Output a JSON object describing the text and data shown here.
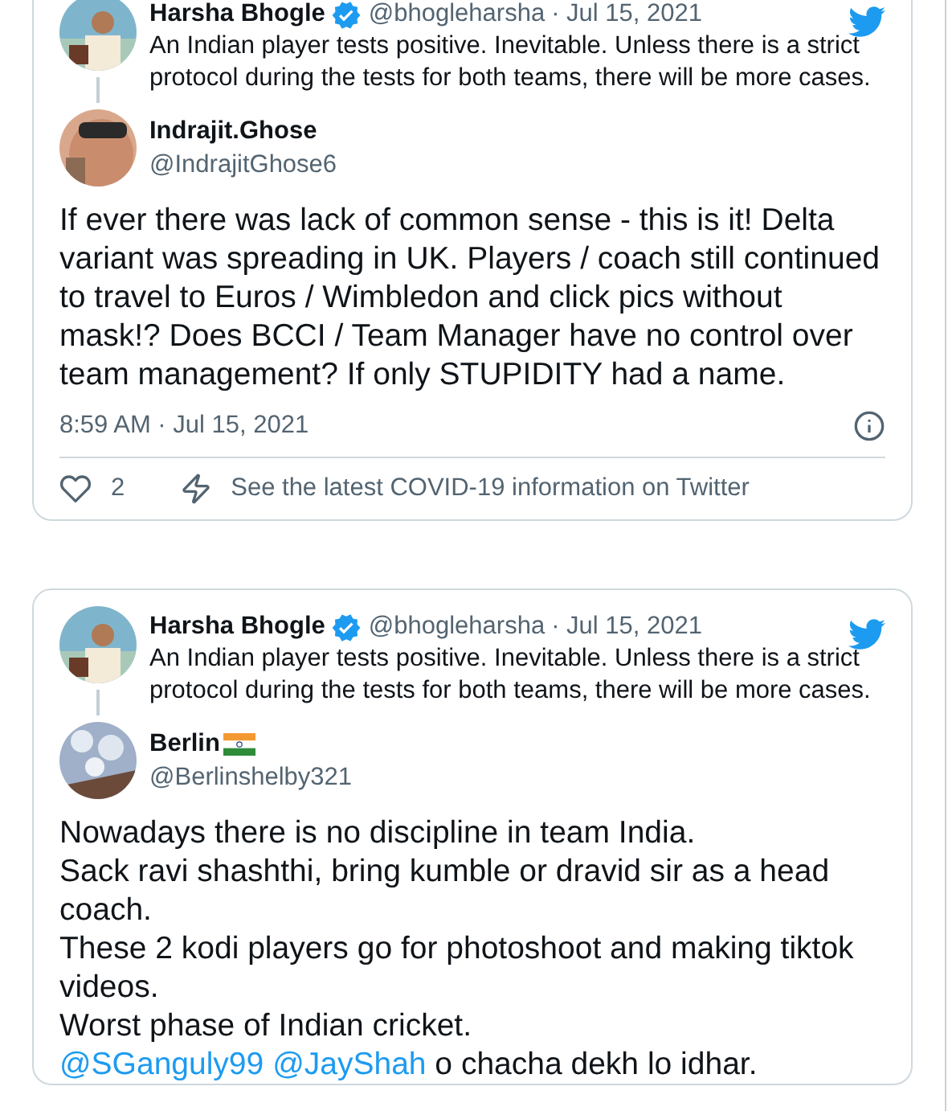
{
  "cards": [
    {
      "quoted": {
        "name": "Harsha Bhogle",
        "verified": true,
        "handle": "@bhogleharsha",
        "date": "· Jul 15, 2021",
        "text": "An Indian player tests positive. Inevitable. Unless there is a strict protocol during the tests for both teams, there will be more cases."
      },
      "reply": {
        "name": "Indrajit.Ghose",
        "handle": "@IndrajitGhose6",
        "body": [
          {
            "kind": "text",
            "text": "If ever there was lack of common sense - this is it! Delta variant was spreading in UK. Players / coach still continued to travel to Euros / Wimbledon and click pics without mask!? Does BCCI / Team Manager have no control over team management? If only STUPIDITY had a name."
          }
        ]
      },
      "timestamp": "8:59 AM · Jul 15, 2021",
      "likes": "2",
      "covid_link": "See the latest COVID-19 information on Twitter"
    },
    {
      "quoted": {
        "name": "Harsha Bhogle",
        "verified": true,
        "handle": "@bhogleharsha",
        "date": "· Jul 15, 2021",
        "text": "An Indian player tests positive. Inevitable. Unless there is a strict protocol during the tests for both teams, there will be more cases."
      },
      "reply": {
        "name": "Berlin",
        "flag": true,
        "handle": "@Berlinshelby321",
        "body": [
          {
            "kind": "text",
            "text": "Nowadays there is no discipline in team India.\nSack ravi shashthi, bring kumble or dravid sir as a head coach.\nThese 2 kodi players go for photoshoot and making tiktok videos.\nWorst phase of Indian cricket.\n"
          },
          {
            "kind": "mention",
            "text": "@SGanguly99"
          },
          {
            "kind": "mention",
            "text": "@JayShah"
          },
          {
            "kind": "text",
            "text": " o chacha dekh lo idhar."
          }
        ]
      }
    }
  ]
}
